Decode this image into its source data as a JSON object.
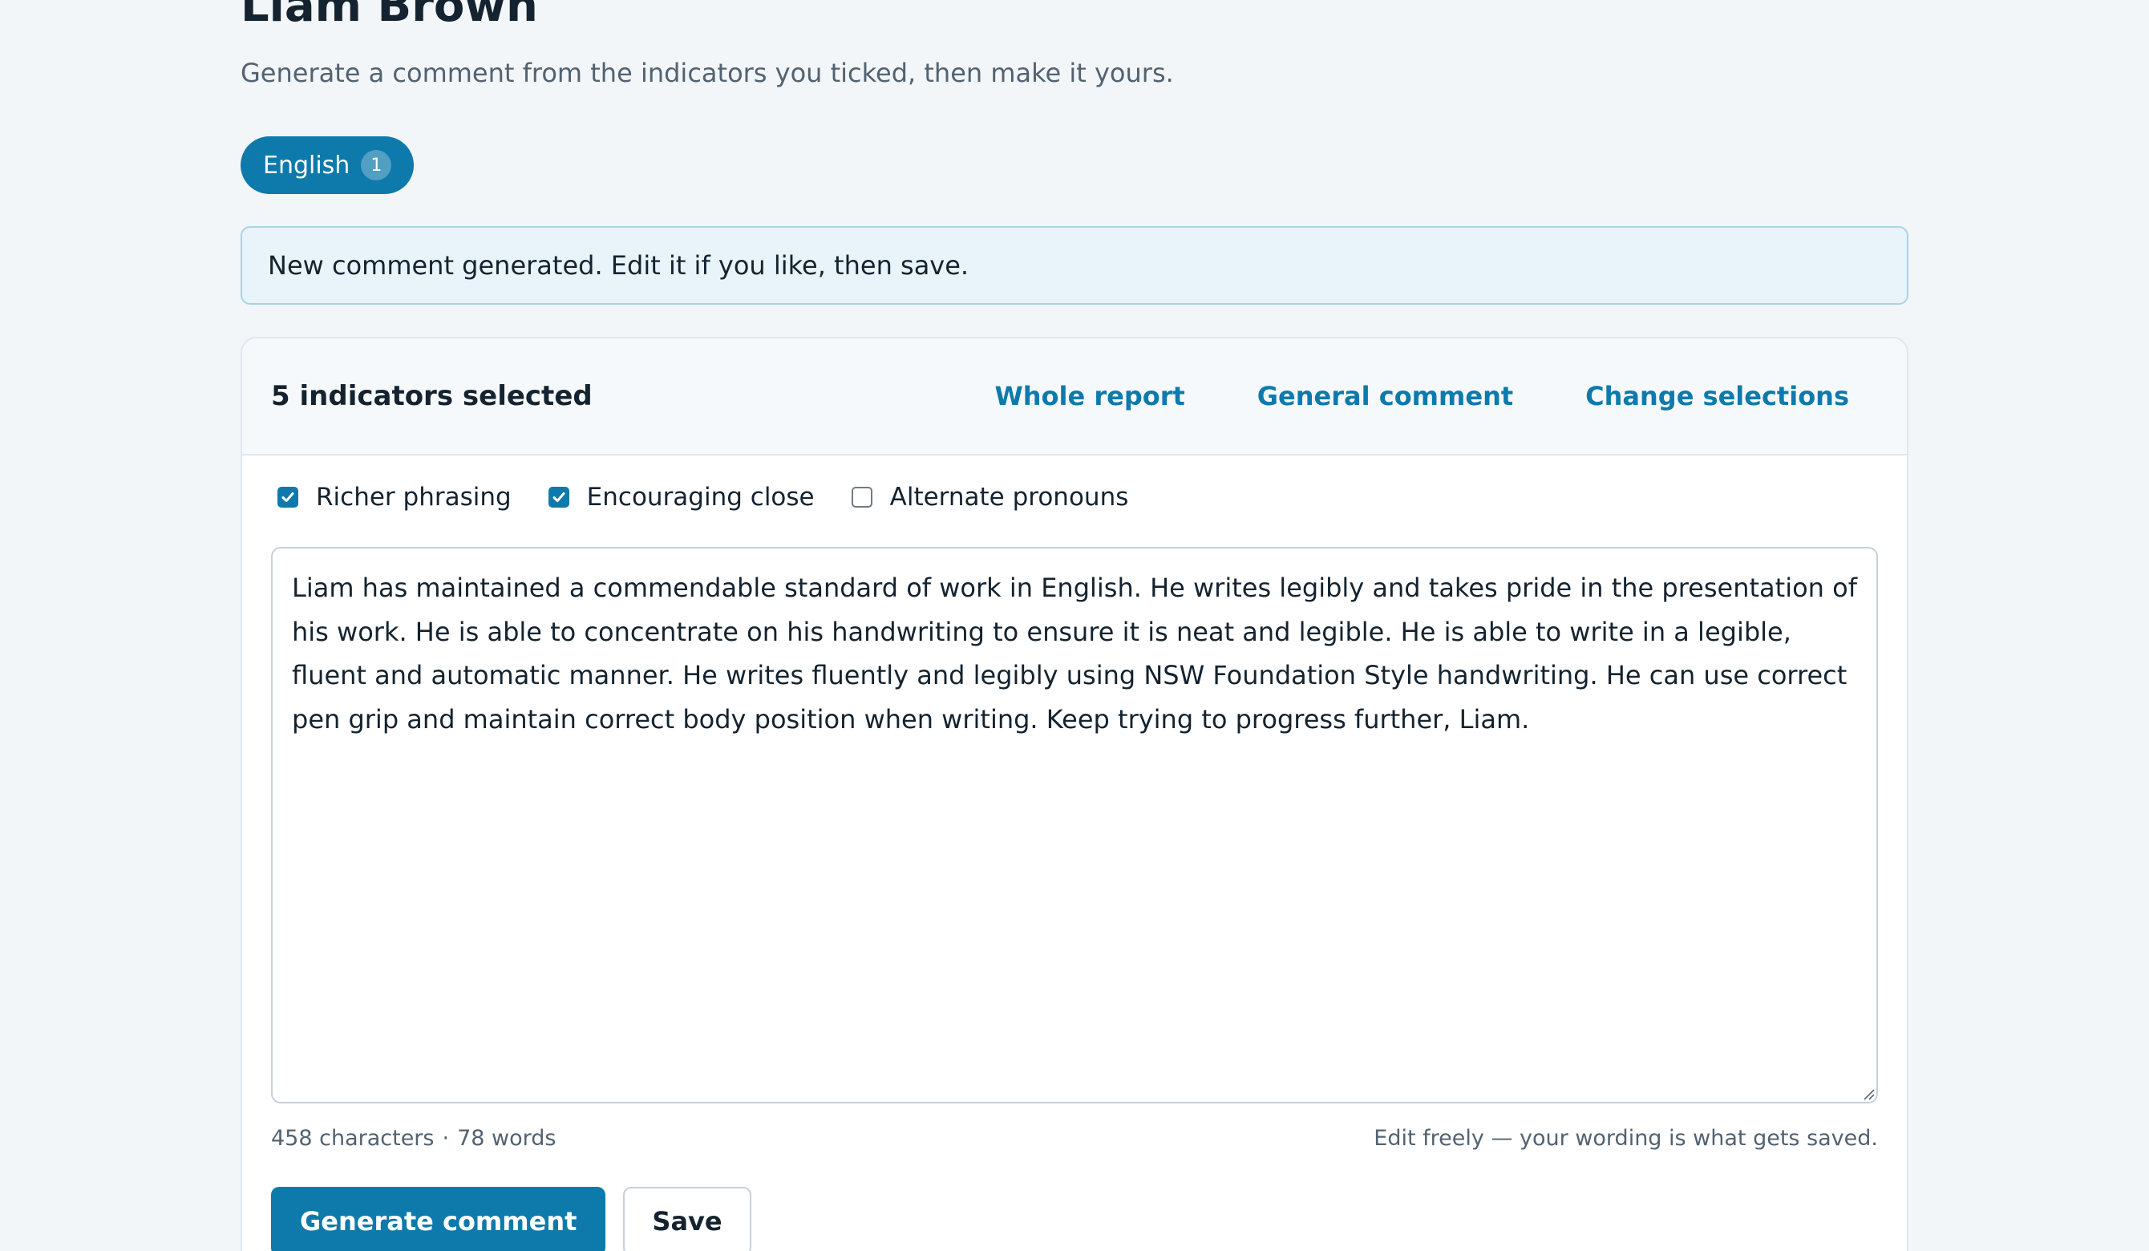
{
  "header": {
    "student_name": "Liam Brown",
    "subtitle": "Generate a comment from the indicators you ticked, then make it yours."
  },
  "subject_tab": {
    "label": "English",
    "count": "1"
  },
  "notice": {
    "text": "New comment generated. Edit it if you like, then save."
  },
  "card": {
    "title": "5 indicators selected",
    "links": {
      "whole_report": "Whole report",
      "general_comment": "General comment",
      "change_selections": "Change selections"
    }
  },
  "options": [
    {
      "label": "Richer phrasing",
      "checked": true
    },
    {
      "label": "Encouraging close",
      "checked": true
    },
    {
      "label": "Alternate pronouns",
      "checked": false
    }
  ],
  "comment": {
    "text": "Liam has maintained a commendable standard of work in English. He writes legibly and takes pride in the presentation of his work. He is able to concentrate on his handwriting to ensure it is neat and legible. He is able to write in a legible, fluent and automatic manner. He writes fluently and legibly using NSW Foundation Style handwriting. He can use correct pen grip and maintain correct body position when writing. Keep trying to progress further, Liam."
  },
  "stats": {
    "characters": "458 characters",
    "separator": "·",
    "words": "78 words"
  },
  "hint": "Edit freely — your wording is what gets saved.",
  "actions": {
    "generate_label": "Generate comment",
    "save_label": "Save"
  },
  "colors": {
    "accent": "#0e7aab",
    "background": "#f2f6f9",
    "notice_bg": "#e8f3fa"
  },
  "icons": {
    "checkbox_checked": "check-icon",
    "textarea_grip": "resize-grip-icon"
  }
}
